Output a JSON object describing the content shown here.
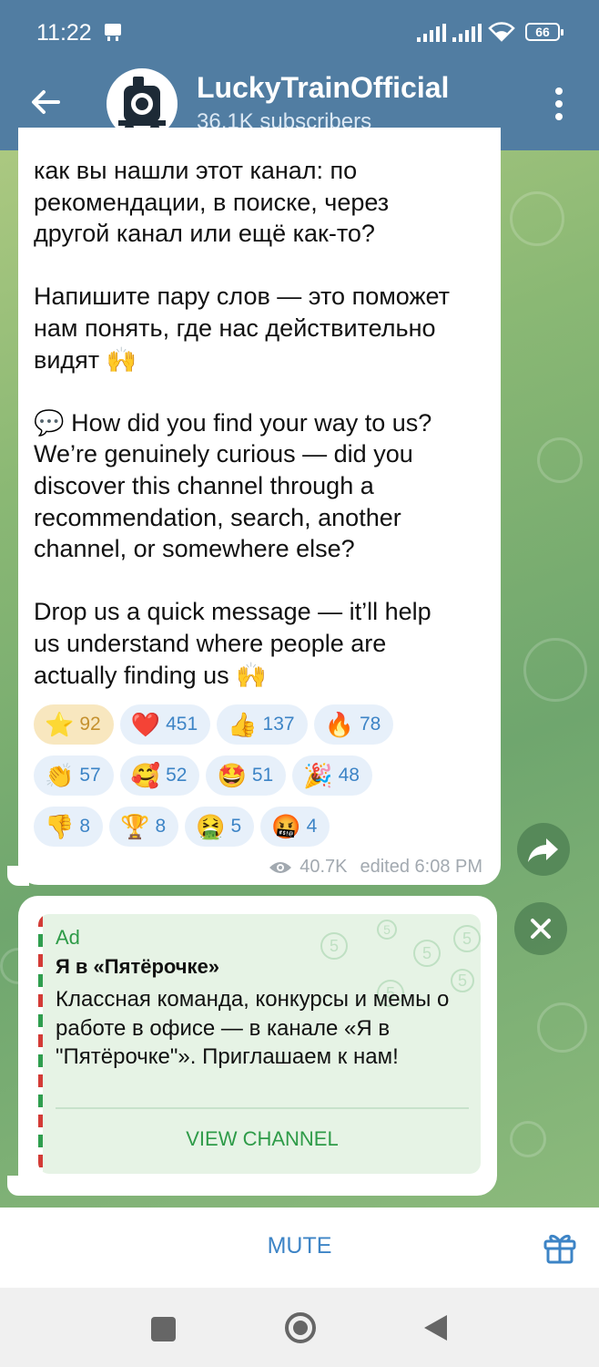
{
  "status_bar": {
    "time": "11:22",
    "battery": "66"
  },
  "header": {
    "title": "LuckyTrainOfficial",
    "subtitle": "36.1K subscribers"
  },
  "message": {
    "text_ru_1": "как вы нашли этот канал: по\nрекомендации, в поиске, через\nдругой канал или ещё как-то?",
    "text_ru_2": "Напишите пару слов — это поможет\nнам понять, где нас действительно\nвидят 🙌",
    "text_en_1": "💬 How did you find your way to us?\nWe’re genuinely curious — did you\ndiscover this channel through a\nrecommendation, search, another\nchannel, or somewhere else?",
    "text_en_2": "Drop us a quick message — it’ll help\nus understand where people are\nactually finding us 🙌",
    "reactions": [
      {
        "emoji": "⭐",
        "count": "92"
      },
      {
        "emoji": "❤️",
        "count": "451"
      },
      {
        "emoji": "👍",
        "count": "137"
      },
      {
        "emoji": "🔥",
        "count": "78"
      },
      {
        "emoji": "👏",
        "count": "57"
      },
      {
        "emoji": "🥰",
        "count": "52"
      },
      {
        "emoji": "🤩",
        "count": "51"
      },
      {
        "emoji": "🎉",
        "count": "48"
      },
      {
        "emoji": "👎",
        "count": "8"
      },
      {
        "emoji": "🏆",
        "count": "8"
      },
      {
        "emoji": "🤮",
        "count": "5"
      },
      {
        "emoji": "🤬",
        "count": "4"
      }
    ],
    "views": "40.7K",
    "edited": "edited 6:08 PM"
  },
  "ad": {
    "label": "Ad",
    "title": "Я в «Пятёрочке»",
    "text": "Классная команда, конкурсы и мемы о работе в офисе — в канале «Я в \"Пятёрочке\"». Приглашаем к нам!",
    "button": "VIEW CHANNEL",
    "watermark": "5"
  },
  "bottom": {
    "mute_label": "MUTE"
  },
  "colors": {
    "header_bg": "#517da2",
    "accent_blue": "#3d84c6",
    "ad_green": "#2e9b48"
  },
  "icons": [
    "back-arrow-icon",
    "more-vertical-icon",
    "forward-icon",
    "close-icon",
    "eye-icon",
    "gift-icon",
    "signal-icon",
    "wifi-icon",
    "battery-icon"
  ]
}
